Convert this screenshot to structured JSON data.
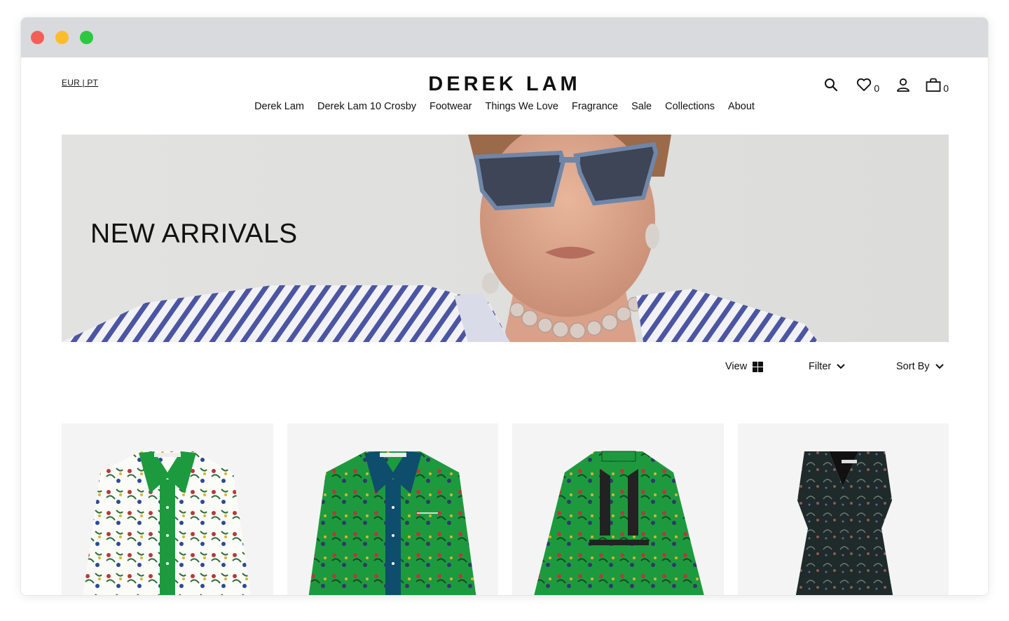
{
  "currency": {
    "label": "EUR | PT"
  },
  "brand": {
    "logo": "DEREK LAM"
  },
  "header_icons": {
    "search": "search-icon",
    "wishlist": {
      "icon": "heart-icon",
      "count": "0"
    },
    "account": "user-icon",
    "bag": {
      "icon": "shopping-bag-icon",
      "count": "0"
    }
  },
  "nav": {
    "items": [
      {
        "label": "Derek Lam"
      },
      {
        "label": "Derek Lam 10 Crosby"
      },
      {
        "label": "Footwear"
      },
      {
        "label": "Things We Love"
      },
      {
        "label": "Fragrance"
      },
      {
        "label": "Sale"
      },
      {
        "label": "Collections"
      },
      {
        "label": "About"
      }
    ]
  },
  "hero": {
    "title": "NEW ARRIVALS"
  },
  "toolbar": {
    "view_label": "View",
    "filter_label": "Filter",
    "sort_label": "Sort By"
  },
  "products": [
    {
      "name": "white floral shirt",
      "colors": [
        "#ffffff",
        "#1e9a3e"
      ]
    },
    {
      "name": "green floral pajama shirt",
      "colors": [
        "#1e9a3e",
        "#0e4d6b"
      ]
    },
    {
      "name": "green floral dress",
      "colors": [
        "#1e9a3e",
        "#222222"
      ]
    },
    {
      "name": "black floral sleeveless dress",
      "colors": [
        "#1f2a2a",
        "#6a7c78"
      ]
    }
  ],
  "colors": {
    "titlebar": "#d8dadd",
    "brand_green": "#1e9a3e",
    "text": "#111111"
  }
}
